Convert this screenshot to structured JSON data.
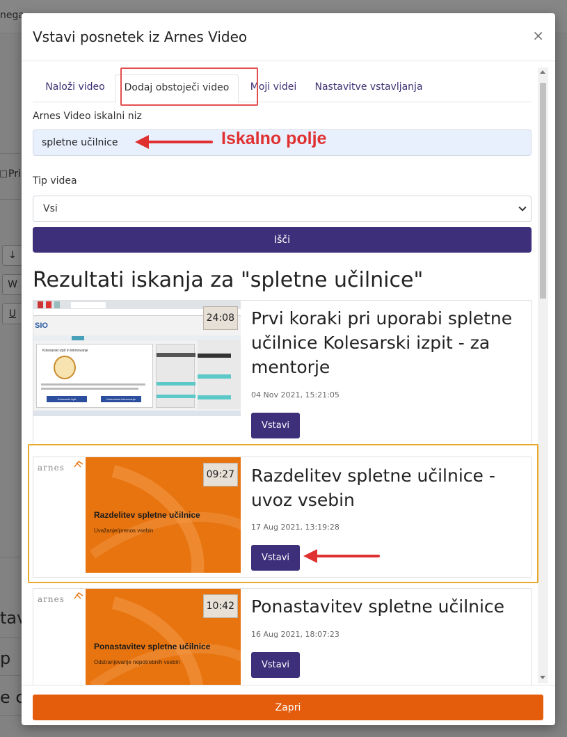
{
  "background": {
    "topbar_text": "nega",
    "side_label": "Pri",
    "big_texts": [
      "tav",
      "p",
      "e c"
    ]
  },
  "modal": {
    "title": "Vstavi posnetek iz Arnes Video",
    "close_glyph": "×",
    "tabs": [
      {
        "label": "Naloži video"
      },
      {
        "label": "Dodaj obstoječi video"
      },
      {
        "label": "Moji videi"
      },
      {
        "label": "Nastavitve vstavljanja"
      }
    ],
    "active_tab": "Dodaj obstoječi video",
    "search_label": "Arnes Video iskalni niz",
    "search_value": "spletne učilnice",
    "search_annotation": "Iskalno polje",
    "type_label": "Tip videa",
    "type_value": "Vsi",
    "search_button": "Išči",
    "results_heading": "Rezultati iskanja za \"spletne učilnice\"",
    "results": [
      {
        "title": "Prvi koraki pri uporabi spletne učilnice Kolesarski izpit - za mentorje",
        "date": "04 Nov 2021, 15:21:05",
        "duration": "24:08",
        "button": "Vstavi",
        "thumb": {
          "heading": "SIO",
          "page_title": "Kolesarski izpit in tekmovanje",
          "btn_a": "Kolesarski izpit",
          "btn_b": "Kolesarska tekmovanja"
        }
      },
      {
        "title": "Razdelitev spletne učilnice - uvoz vsebin",
        "date": "17 Aug 2021, 13:19:28",
        "duration": "09:27",
        "button": "Vstavi",
        "thumb": {
          "logo": "arnes",
          "heading": "Razdelitev spletne učilnice",
          "sub": "Uvažanje/prenos vsebin"
        }
      },
      {
        "title": "Ponastavitev spletne učilnice",
        "date": "16 Aug 2021, 18:07:23",
        "duration": "10:42",
        "button": "Vstavi",
        "thumb": {
          "logo": "arnes",
          "heading": "Ponastavitev spletne učilnice",
          "sub": "Odstranjevanje nepotrebnih vsebin"
        }
      }
    ],
    "footer_button": "Zapri"
  },
  "colors": {
    "primary": "#3d2f7a",
    "footer_button": "#e35d0c",
    "annotation_red": "#e03131",
    "highlight_orange": "#e9a82a",
    "thumb_orange": "#e8740f"
  }
}
